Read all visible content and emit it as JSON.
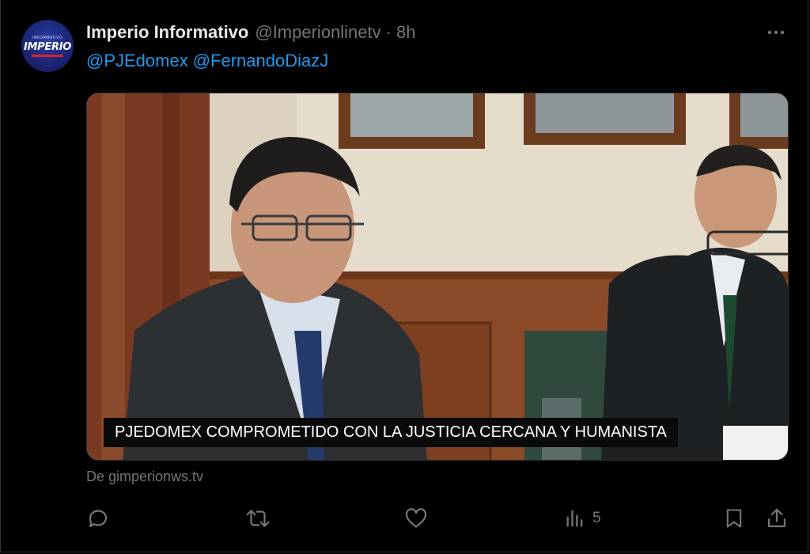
{
  "tweet": {
    "author": {
      "display_name": "Imperio Informativo",
      "handle": "@Imperionlinetv",
      "separator": "·",
      "time": "8h",
      "avatar_brand": "IMPERIO",
      "avatar_tagline": "INFORMATIVO"
    },
    "mentions": [
      "@PJEdomex",
      "@FernandoDiazJ"
    ],
    "media": {
      "caption": "PJEDOMEX COMPROMETIDO CON LA JUSTICIA CERCANA Y HUMANISTA"
    },
    "link_source": "De gimperionws.tv",
    "actions": {
      "reply_icon": "reply-icon",
      "retweet_icon": "retweet-icon",
      "like_icon": "heart-icon",
      "views_icon": "analytics-icon",
      "views_count": "5",
      "bookmark_icon": "bookmark-icon",
      "share_icon": "share-icon"
    }
  }
}
